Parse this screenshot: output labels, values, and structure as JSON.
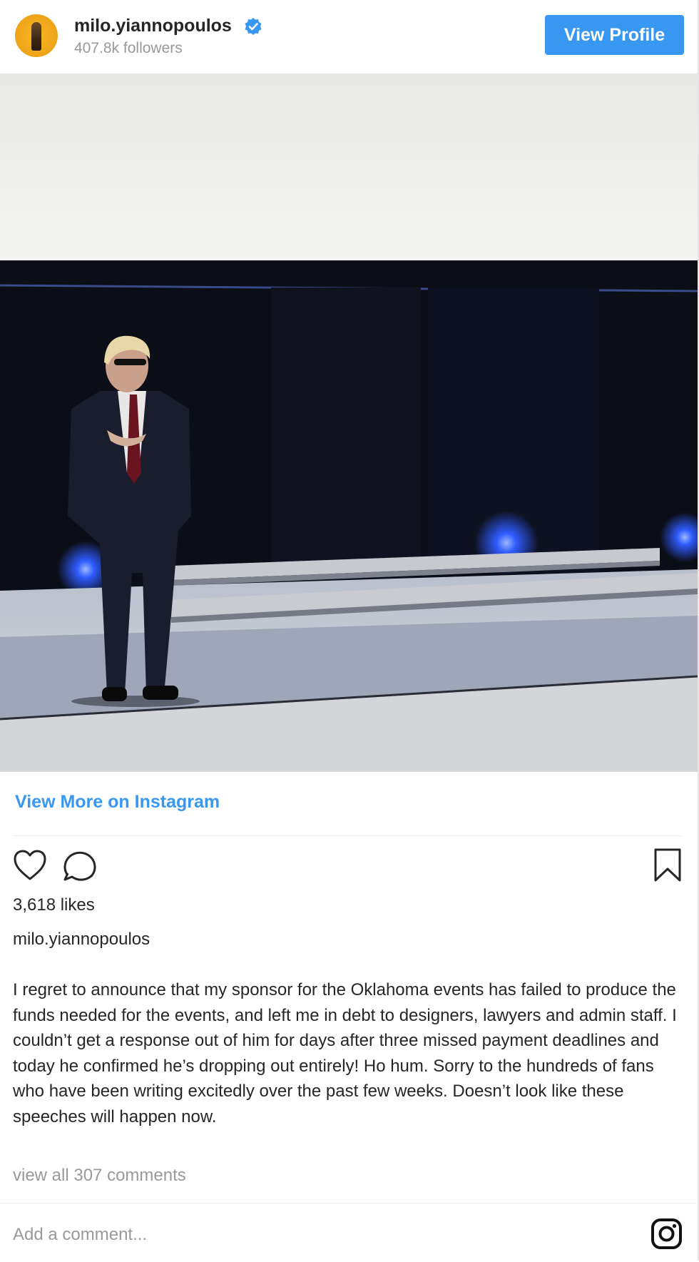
{
  "header": {
    "username": "milo.yiannopoulos",
    "followers": "407.8k followers",
    "view_profile_label": "View Profile"
  },
  "post": {
    "view_more_label": "View More on Instagram",
    "likes": "3,618 likes",
    "owner": "milo.yiannopoulos",
    "caption": "I regret to announce that my sponsor for the Oklahoma events has failed to produce the funds needed for the events, and left me in debt to designers, lawyers and admin staff. I couldn’t get a response out of him for days after three missed payment deadlines and today he confirmed he’s dropping out entirely! Ho hum. Sorry to the hundreds of fans who have been writing excitedly over the past few weeks. Doesn’t look like these speeches will happen now.",
    "view_comments_label": "view all 307 comments",
    "comment_placeholder": "Add a comment..."
  },
  "colors": {
    "accent": "#3897f0",
    "text": "#262626",
    "muted": "#999999"
  },
  "icons": [
    "verified-badge-icon",
    "heart-icon",
    "comment-icon",
    "bookmark-icon",
    "instagram-logo-icon"
  ]
}
